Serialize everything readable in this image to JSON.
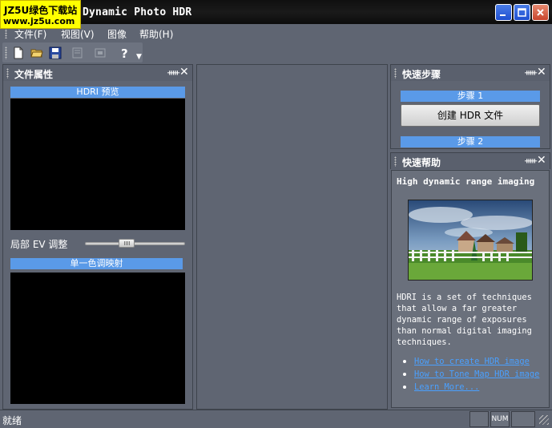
{
  "window": {
    "title": "Dynamic Photo HDR",
    "watermark_line1": "JZ5U绿色下载站",
    "watermark_line2": "www.jz5u.com"
  },
  "menu": [
    "文件(F)",
    "视图(V)",
    "图像",
    "帮助(H)"
  ],
  "toolbar": {
    "icons": [
      "new-file-icon",
      "open-folder-icon",
      "save-icon",
      "disabled-tool-icon",
      "disabled-tool-icon-2",
      "help-icon"
    ]
  },
  "left_panel": {
    "title": "文件属性",
    "pin": "ꟼ",
    "close": "✕",
    "preview_label": "HDRI 预览",
    "slider_label": "局部 EV 调整",
    "slider_value": 0.4,
    "tonemap_label": "单一色调映射"
  },
  "steps_panel": {
    "title": "快速步骤",
    "step1": "步骤 1",
    "create_button": "创建 HDR 文件",
    "step2": "步骤 2"
  },
  "help_panel": {
    "title": "快速帮助",
    "heading": "High dynamic range imaging",
    "body": "HDRI is a set of techniques that allow a far greater dynamic range of exposures than normal digital imaging techniques.",
    "links": [
      "How to create HDR image",
      "How to Tone Map HDR image",
      "Learn More..."
    ]
  },
  "status": {
    "text": "就绪",
    "num": "NUM"
  }
}
